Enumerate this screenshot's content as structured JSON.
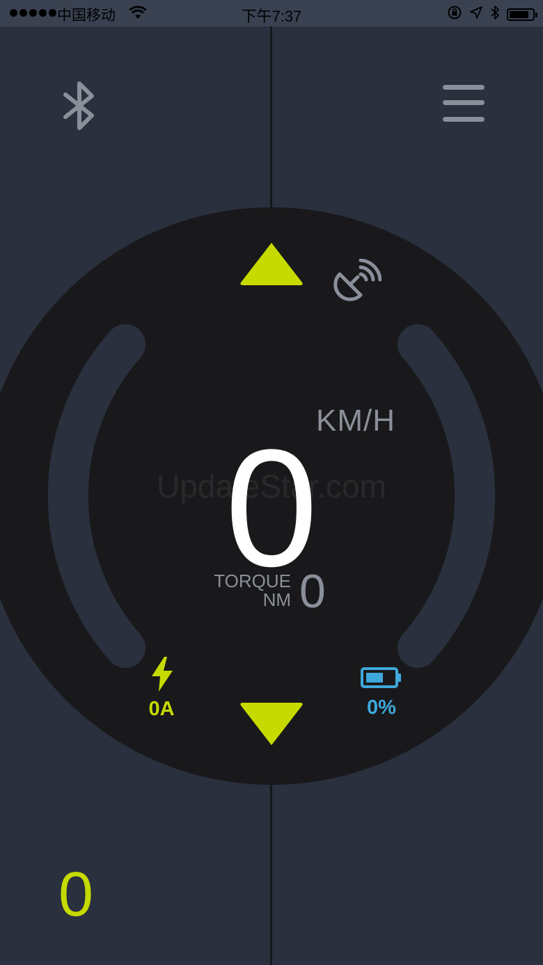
{
  "status_bar": {
    "carrier": "中国移动",
    "time": "下午7:37",
    "battery_level": 0.85
  },
  "top_bar": {
    "bluetooth_icon": "bluetooth-icon",
    "menu_icon": "hamburger-menu-icon"
  },
  "gauge": {
    "speed": "0",
    "unit": "KM/H",
    "torque_label_line1": "TORQUE",
    "torque_label_line2": "NM",
    "torque_value": "0",
    "current": "0A",
    "battery": "0%",
    "watermark": "UpdateStar.com",
    "gps_icon": "satellite-dish-icon",
    "current_icon": "lightning-bolt-icon",
    "battery_icon": "battery-icon"
  },
  "bottom": {
    "value": "0"
  },
  "colors": {
    "background": "#2a303d",
    "status_bar": "#3a4252",
    "gauge": "#19191b",
    "accent_green": "#c6da00",
    "accent_blue": "#3fa9dc",
    "text_gray": "#8a8f99",
    "track": "#2a303d"
  }
}
